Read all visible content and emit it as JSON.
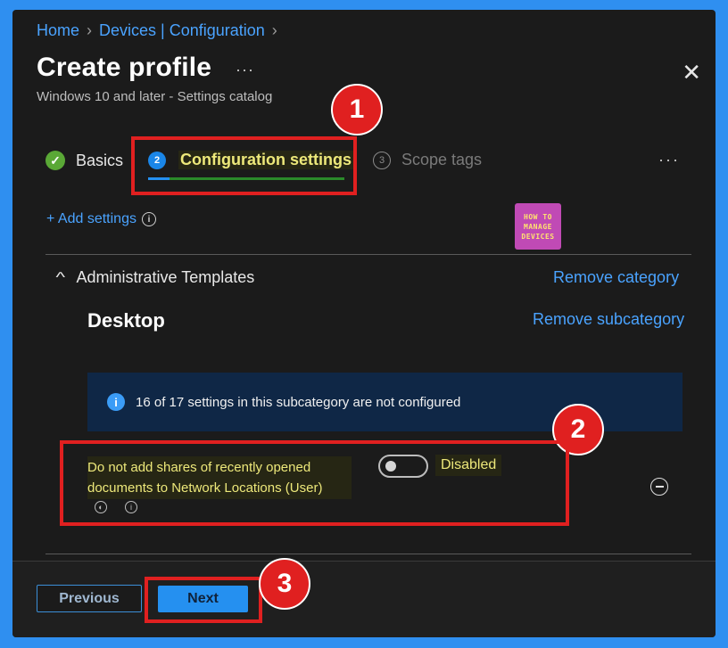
{
  "breadcrumb": {
    "home": "Home",
    "devices": "Devices | Configuration"
  },
  "header": {
    "title": "Create profile",
    "more": "···",
    "subtitle": "Windows 10 and later - Settings catalog",
    "close": "✕"
  },
  "steps": [
    {
      "label": "Basics",
      "number": "✓",
      "state": "completed"
    },
    {
      "label": "Configuration settings",
      "number": "2",
      "state": "current"
    },
    {
      "label": "Scope tags",
      "number": "3",
      "state": "pending"
    }
  ],
  "steps_more": "···",
  "add_settings": {
    "label": "+ Add settings",
    "info": "i"
  },
  "logo": {
    "line1": "HOW TO",
    "line2": "MANAGE",
    "line3": "DEVICES"
  },
  "category": {
    "name": "Administrative Templates",
    "remove_label": "Remove category",
    "subcategory": "Desktop",
    "remove_sub_label": "Remove subcategory"
  },
  "info_banner": {
    "text": "16 of 17 settings in this subcategory are not configured"
  },
  "setting": {
    "label": "Do not add shares of recently opened documents to Network Locations (User)",
    "value": "Disabled",
    "enabled": false
  },
  "annotations": [
    "1",
    "2",
    "3"
  ],
  "footer": {
    "previous": "Previous",
    "next": "Next"
  },
  "colors": {
    "accent": "#2590f0",
    "highlight_box": "#e02020",
    "link": "#4aa3ff",
    "background": "#1b1b1b"
  }
}
